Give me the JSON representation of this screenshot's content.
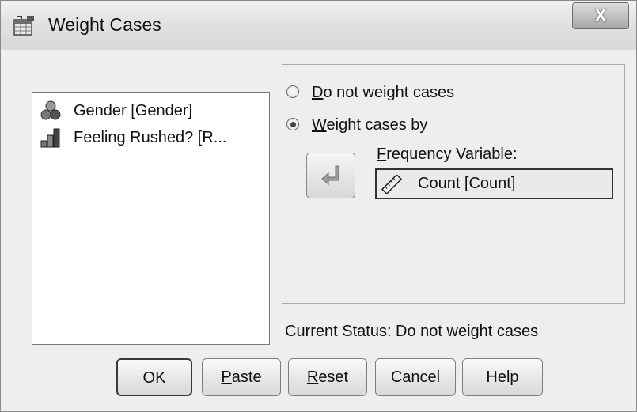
{
  "window": {
    "title": "Weight Cases",
    "close_label": "X"
  },
  "variables": [
    {
      "label": "Gender [Gender]",
      "icon": "nominal-variable-icon"
    },
    {
      "label": "Feeling Rushed? [R...",
      "icon": "ordinal-variable-icon"
    }
  ],
  "options": {
    "do_not_weight": {
      "accel": "D",
      "rest": "o not weight cases",
      "selected": false
    },
    "weight_by": {
      "accel": "W",
      "rest": "eight cases by",
      "selected": true
    }
  },
  "frequency": {
    "label_accel": "F",
    "label_rest": "requency Variable:",
    "value": "Count [Count]",
    "icon": "scale-variable-icon"
  },
  "move_button": {
    "icon": "arrow-move-icon"
  },
  "status": "Current Status: Do not weight cases",
  "buttons": {
    "ok": "OK",
    "paste": {
      "accel": "P",
      "rest": "aste"
    },
    "reset": {
      "accel": "R",
      "rest": "eset"
    },
    "cancel": "Cancel",
    "help": "Help"
  }
}
